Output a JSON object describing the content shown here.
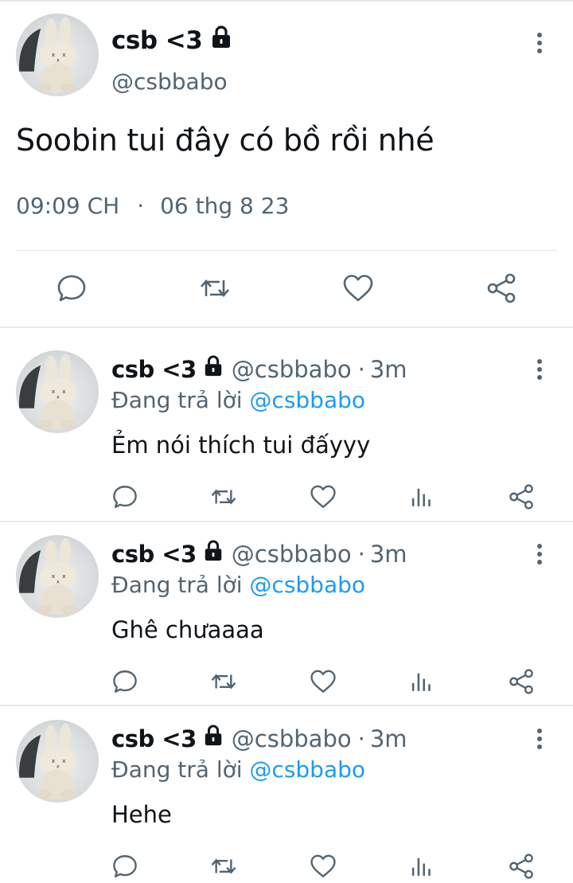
{
  "main_tweet": {
    "display_name": "csb <3",
    "handle": "@csbbabo",
    "text": "Soobin tui đây có bồ rồi nhé",
    "time": "09:09 CH",
    "separator": "·",
    "date": "06 thg 8 23",
    "protected_icon": "lock-icon",
    "actions": [
      "reply-icon",
      "retweet-icon",
      "like-icon",
      "share-icon"
    ]
  },
  "replies": [
    {
      "display_name": "csb <3",
      "handle": "@csbbabo",
      "separator": "·",
      "time": "3m",
      "replying_prefix": "Đang trả lời ",
      "replying_to": "@csbbabo",
      "text": "Ẻm nói thích tui đấyyy"
    },
    {
      "display_name": "csb <3",
      "handle": "@csbbabo",
      "separator": "·",
      "time": "3m",
      "replying_prefix": "Đang trả lời ",
      "replying_to": "@csbbabo",
      "text": "Ghê chưaaaa"
    },
    {
      "display_name": "csb <3",
      "handle": "@csbbabo",
      "separator": "·",
      "time": "3m",
      "replying_prefix": "Đang trả lời ",
      "replying_to": "@csbbabo",
      "text": "Hehe"
    }
  ],
  "reply_actions": [
    "reply-icon",
    "retweet-icon",
    "like-icon",
    "views-icon",
    "share-icon"
  ],
  "colors": {
    "text": "#0f1419",
    "secondary": "#536471",
    "mention": "#1d9bf0",
    "divider": "#e1e6ea"
  }
}
